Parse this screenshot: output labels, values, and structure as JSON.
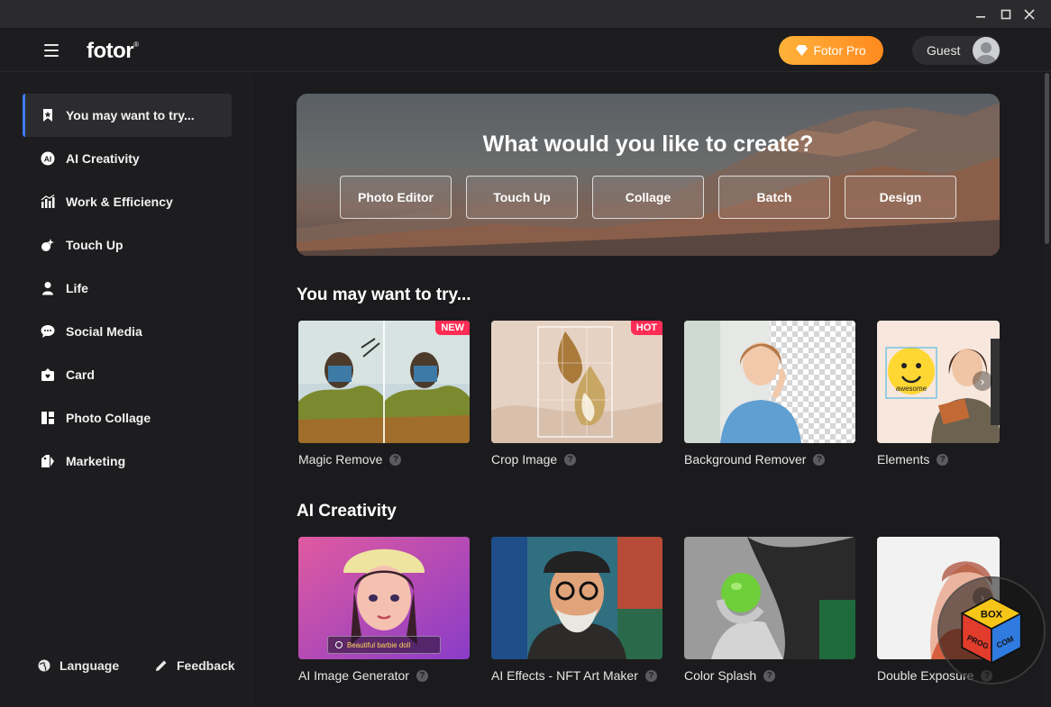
{
  "header": {
    "logo": "fotor",
    "logo_mark": "®",
    "pro_label": "Fotor Pro",
    "guest_label": "Guest"
  },
  "sidebar": {
    "items": [
      {
        "label": "You may want to try...",
        "icon": "bookmark-star-icon",
        "active": true
      },
      {
        "label": "AI Creativity",
        "icon": "ai-icon"
      },
      {
        "label": "Work & Efficiency",
        "icon": "chart-icon"
      },
      {
        "label": "Touch Up",
        "icon": "sparkle-brush-icon"
      },
      {
        "label": "Life",
        "icon": "person-icon"
      },
      {
        "label": "Social Media",
        "icon": "chat-bubble-icon"
      },
      {
        "label": "Card",
        "icon": "card-icon"
      },
      {
        "label": "Photo Collage",
        "icon": "collage-icon"
      },
      {
        "label": "Marketing",
        "icon": "tag-icon"
      }
    ],
    "language": "Language",
    "feedback": "Feedback"
  },
  "hero": {
    "title": "What would you like to create?",
    "buttons": [
      "Photo Editor",
      "Touch Up",
      "Collage",
      "Batch",
      "Design"
    ]
  },
  "sections": [
    {
      "title": "You may want to try...",
      "cards": [
        {
          "label": "Magic Remove",
          "badge": "NEW"
        },
        {
          "label": "Crop Image",
          "badge": "HOT"
        },
        {
          "label": "Background Remover",
          "badge": ""
        },
        {
          "label": "Elements",
          "badge": ""
        }
      ]
    },
    {
      "title": "AI Creativity",
      "cards": [
        {
          "label": "AI Image Generator",
          "badge": "",
          "overlay": "Beautiful barbie doll"
        },
        {
          "label": "AI Effects - NFT Art Maker",
          "badge": ""
        },
        {
          "label": "Color Splash",
          "badge": ""
        },
        {
          "label": "Double Exposure",
          "badge": ""
        }
      ]
    }
  ],
  "sticker_text": "awesome",
  "watermark": {
    "top": "BOX",
    "left": "PROG",
    "right": "COM"
  },
  "help_glyph": "?",
  "colors": {
    "accent": "#3d7bf5",
    "pro_start": "#ffb23a",
    "pro_end": "#ff8a1f",
    "badge": "#ff2d55",
    "bg": "#1b1b1d"
  }
}
